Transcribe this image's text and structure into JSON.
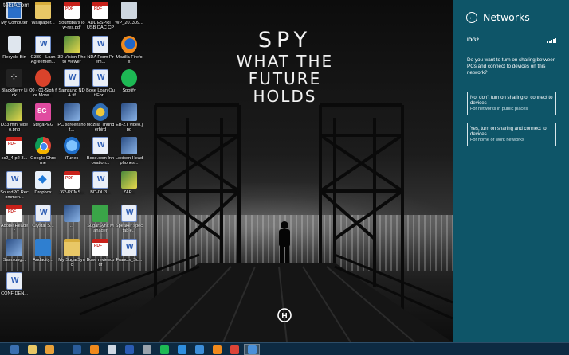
{
  "watermark": "tekiAcom",
  "wallpaper": {
    "line1": "SPY",
    "line2": "WHAT THE",
    "line3": "FUTURE HOLDS"
  },
  "desktop_icons": [
    {
      "label": "My Computer",
      "icon": "pc-icon",
      "kind": "pc"
    },
    {
      "label": "Wallpaper...",
      "icon": "folder-icon",
      "kind": "folder"
    },
    {
      "label": "Soundbars low-res.pdf",
      "icon": "pdf-icon",
      "kind": "pdf"
    },
    {
      "label": "ADL ESPRIT USB DAC CPL",
      "icon": "pdf-icon",
      "kind": "pdf"
    },
    {
      "label": "WP_201309...",
      "icon": "shortcut-icon",
      "kind": "shortcut"
    },
    {
      "label": "Recycle Bin",
      "icon": "recycle-bin-icon",
      "kind": "bin"
    },
    {
      "label": "G330 - Loan Agreemen...",
      "icon": "document-icon",
      "kind": "doc"
    },
    {
      "label": "3D Vision Photo Viewer",
      "icon": "image-icon",
      "kind": "img"
    },
    {
      "label": "NDA Form Prem...",
      "icon": "document-icon",
      "kind": "doc"
    },
    {
      "label": "Mozilla Firefox",
      "icon": "firefox-icon",
      "kind": "firefox"
    },
    {
      "label": "BlackBerry Link",
      "icon": "blackberry-icon",
      "kind": "bb"
    },
    {
      "label": "00 - 01-Sigh for More...",
      "icon": "audio-icon",
      "kind": "red"
    },
    {
      "label": "Samsung NDA.tif",
      "icon": "document-icon",
      "kind": "doc"
    },
    {
      "label": "Bose Loan Out For...",
      "icon": "document-icon",
      "kind": "doc"
    },
    {
      "label": "Spotify",
      "icon": "spotify-icon",
      "kind": "spotify"
    },
    {
      "label": "D33 mini video.png",
      "icon": "image-icon",
      "kind": "img"
    },
    {
      "label": "StegaPEG",
      "icon": "stegapeg-icon",
      "kind": "sg"
    },
    {
      "label": "PC screenshot...",
      "icon": "image-icon",
      "kind": "photo"
    },
    {
      "label": "Mozilla Thunderbird",
      "icon": "thunderbird-icon",
      "kind": "mozthund"
    },
    {
      "label": "EB-ZT video.jpg",
      "icon": "image-icon",
      "kind": "photo"
    },
    {
      "label": "sc2_4-p2-3...",
      "icon": "pdf-icon",
      "kind": "pdf"
    },
    {
      "label": "Google Chrome",
      "icon": "chrome-icon",
      "kind": "chrome"
    },
    {
      "label": "iTunes",
      "icon": "itunes-icon",
      "kind": "itunes"
    },
    {
      "label": "Bose.com Innovation...",
      "icon": "document-icon",
      "kind": "doc"
    },
    {
      "label": "Lexicon Headphones...",
      "icon": "image-icon",
      "kind": "photo"
    },
    {
      "label": "SoundPC Recommen...",
      "icon": "document-icon",
      "kind": "doc"
    },
    {
      "label": "Dropbox",
      "icon": "dropbox-icon",
      "kind": "dropbox"
    },
    {
      "label": "J62-PCMS...",
      "icon": "pdf-icon",
      "kind": "pdf"
    },
    {
      "label": "BD-DU3...",
      "icon": "document-icon",
      "kind": "doc"
    },
    {
      "label": "ZAP...",
      "icon": "image-icon",
      "kind": "img"
    },
    {
      "label": "Adobe Reader",
      "icon": "pdf-icon",
      "kind": "pdf"
    },
    {
      "label": "Crystal S...",
      "icon": "document-icon",
      "kind": "doc"
    },
    {
      "label": "...",
      "icon": "image-icon",
      "kind": "photo"
    },
    {
      "label": "SugarSync Manager",
      "icon": "sugarsync-icon",
      "kind": "green"
    },
    {
      "label": "Speaker spec table...",
      "icon": "document-icon",
      "kind": "doc"
    },
    {
      "label": "Samsung...",
      "icon": "image-icon",
      "kind": "photo"
    },
    {
      "label": "Audacity...",
      "icon": "audacity-icon",
      "kind": "blue"
    },
    {
      "label": "My SugarSync",
      "icon": "folder-icon",
      "kind": "folder"
    },
    {
      "label": "Bose review.pdf",
      "icon": "pdf-icon",
      "kind": "pdf"
    },
    {
      "label": "Francis_Sc...",
      "icon": "document-icon",
      "kind": "doc"
    },
    {
      "label": "CONFIDEN...",
      "icon": "document-icon",
      "kind": "doc"
    }
  ],
  "taskbar": [
    {
      "icon": "file-explorer-icon",
      "color": "#3a6fb0"
    },
    {
      "icon": "folder-icon",
      "color": "#e8c766"
    },
    {
      "icon": "outlook-icon",
      "color": "#e8a13a"
    },
    {
      "icon": "media-player-icon",
      "color": "#2a5c9a"
    },
    {
      "icon": "firefox-icon",
      "color": "#f08a1d"
    },
    {
      "icon": "document-icon",
      "color": "#cfd8e3"
    },
    {
      "icon": "word-icon",
      "color": "#2b5bb3"
    },
    {
      "icon": "tool-icon",
      "color": "#9aa3ad"
    },
    {
      "icon": "spotify-icon",
      "color": "#1db954"
    },
    {
      "icon": "internet-explorer-icon",
      "color": "#2f8fe0"
    },
    {
      "icon": "browser-icon",
      "color": "#3d8ed9"
    },
    {
      "icon": "vlc-icon",
      "color": "#f08a1d"
    },
    {
      "icon": "chrome-icon",
      "color": "#db4437"
    },
    {
      "icon": "monitor-icon",
      "color": "#4a90d9"
    }
  ],
  "panel": {
    "title": "Networks",
    "network_name": "IDG2",
    "question": "Do you want to turn on sharing between PCs and connect to devices on this network?",
    "option_no": {
      "title": "No, don't turn on sharing or connect to devices",
      "subtitle": "For networks in public places"
    },
    "option_yes": {
      "title": "Yes, turn on sharing and connect to devices",
      "subtitle": "For home or work networks"
    },
    "background_color": "#0e5568"
  }
}
